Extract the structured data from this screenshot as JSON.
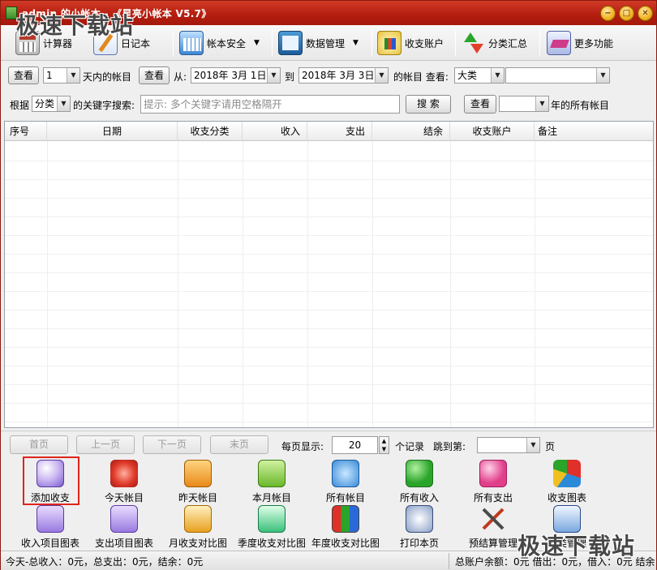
{
  "window": {
    "title": "admin 的小帐本 - 《星亮小帐本 V5.7》",
    "controls": {
      "minimize": "−",
      "restore": "□",
      "close": "✕"
    }
  },
  "toolbar": {
    "items": [
      {
        "label": "计算器",
        "icon": "calculator-icon"
      },
      {
        "label": "日记本",
        "icon": "diary-icon"
      },
      {
        "label": "帐本安全",
        "icon": "account-security-icon",
        "dropdown": "▼"
      },
      {
        "label": "数据管理",
        "icon": "data-management-icon",
        "dropdown": "▼"
      },
      {
        "label": "收支账户",
        "icon": "accounts-icon"
      },
      {
        "label": "分类汇总",
        "icon": "category-summary-icon"
      },
      {
        "label": "更多功能",
        "icon": "more-functions-icon"
      }
    ]
  },
  "filter_row1": {
    "view_button": "查看",
    "days_value": "1",
    "days_suffix": "天内的帐目",
    "view_button2": "查看",
    "from_label": "从:",
    "from_date": "2018年  3月  1日",
    "to_label": "到",
    "to_date": "2018年  3月  3日",
    "accounts_label": "的帐目 查看:",
    "category_select": "大类",
    "subcategory_select": "",
    "extra_select": ""
  },
  "filter_row2": {
    "by_label": "根据",
    "field_select": "分类",
    "keyword_label": "的关键字搜索:",
    "keyword_placeholder": "提示: 多个关键字请用空格隔开",
    "search_button": "搜 索",
    "view_button": "查看",
    "year_value": "",
    "year_suffix": "年的所有帐目"
  },
  "grid": {
    "columns": [
      "序号",
      "日期",
      "收支分类",
      "收入",
      "支出",
      "结余",
      "收支账户",
      "备注"
    ],
    "rows": []
  },
  "pager": {
    "first": "首页",
    "prev": "上一页",
    "next": "下一页",
    "last": "末页",
    "per_page_label": "每页显示:",
    "per_page_value": "20",
    "records_label": "个记录",
    "jump_label": "跳到第:",
    "jump_value": "",
    "page_label": "页"
  },
  "actions": {
    "row1": [
      "添加收支",
      "今天帐目",
      "昨天帐目",
      "本月帐目",
      "所有帐目",
      "所有收入",
      "所有支出",
      "收支图表"
    ],
    "row2": [
      "收入项目图表",
      "支出项目图表",
      "月收支对比图",
      "季度收支对比图",
      "年度收支对比图",
      "打印本页",
      "预结算管理",
      "分类管理"
    ]
  },
  "status": {
    "left": "今天-总收入：0元，总支出：0元，结余：0元",
    "right": "总账户余额：0元 借出：0元，借入：0元 结余"
  },
  "watermark": {
    "text": "极速下载站"
  }
}
